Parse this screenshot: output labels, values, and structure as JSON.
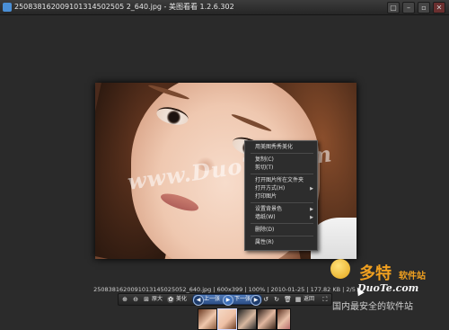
{
  "window": {
    "title": "250838162009101314502505 2_640.jpg - 美图看看 1.2.6.302",
    "buttons": [
      "▢",
      "–",
      "▫",
      "✕"
    ]
  },
  "photo": {
    "watermark": "www.DuoTe.com"
  },
  "context_menu": {
    "items": [
      {
        "label": "用美图秀秀美化",
        "submenu": false
      },
      {
        "label": "复制(C)",
        "submenu": false
      },
      {
        "label": "剪切(T)",
        "submenu": false
      },
      {
        "label": "打开图片所在文件夹",
        "submenu": false
      },
      {
        "label": "打开方式(H)",
        "submenu": true
      },
      {
        "label": "打印图片",
        "submenu": false
      },
      {
        "label": "设置背景色",
        "submenu": true
      },
      {
        "label": "墙纸(W)",
        "submenu": true
      },
      {
        "label": "删除(D)",
        "submenu": false
      },
      {
        "label": "属性(R)",
        "submenu": false
      }
    ]
  },
  "status": {
    "info": "2508381620091013145025052_640.jpg | 600x399 | 100% | 2010-01-25 | 177.82 KB | 2/5"
  },
  "toolbar": {
    "zoom_label": "原大",
    "beautify_label": "美化",
    "prev_label": "上一张",
    "next_label": "下一张",
    "back_label": "返回"
  },
  "brand": {
    "name": "多特",
    "suffix": "软件站",
    "url": "DuoTe.com",
    "slogan": "国内最安全的软件站"
  }
}
